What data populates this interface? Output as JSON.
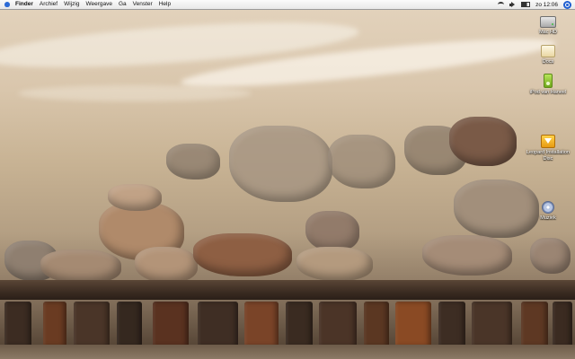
{
  "menubar": {
    "items": [
      "Finder",
      "Archief",
      "Wijzig",
      "Weergave",
      "Ga",
      "Venster",
      "Help"
    ],
    "clock": "zo 12:06",
    "icons": [
      "apple-icon",
      "wifi-icon",
      "volume-icon",
      "battery-icon",
      "spotlight-icon"
    ]
  },
  "desktop": {
    "icons": [
      {
        "label": "Mac HD",
        "icon": "hard-drive-icon"
      },
      {
        "label": "Docs",
        "icon": "document-icon"
      },
      {
        "label": "iPod van Haneel",
        "icon": "ipod-icon"
      },
      {
        "label": "Leopard Installation Disc",
        "icon": "install-disc-icon"
      },
      {
        "label": "Muziek",
        "icon": "disk-icon"
      }
    ]
  },
  "colors": {
    "menubar_bg": "#f2f2f2",
    "spotlight": "#1f5fd1",
    "wallpaper_sand": "#d9c6ac",
    "wallpaper_wood": "#3b2c22"
  }
}
